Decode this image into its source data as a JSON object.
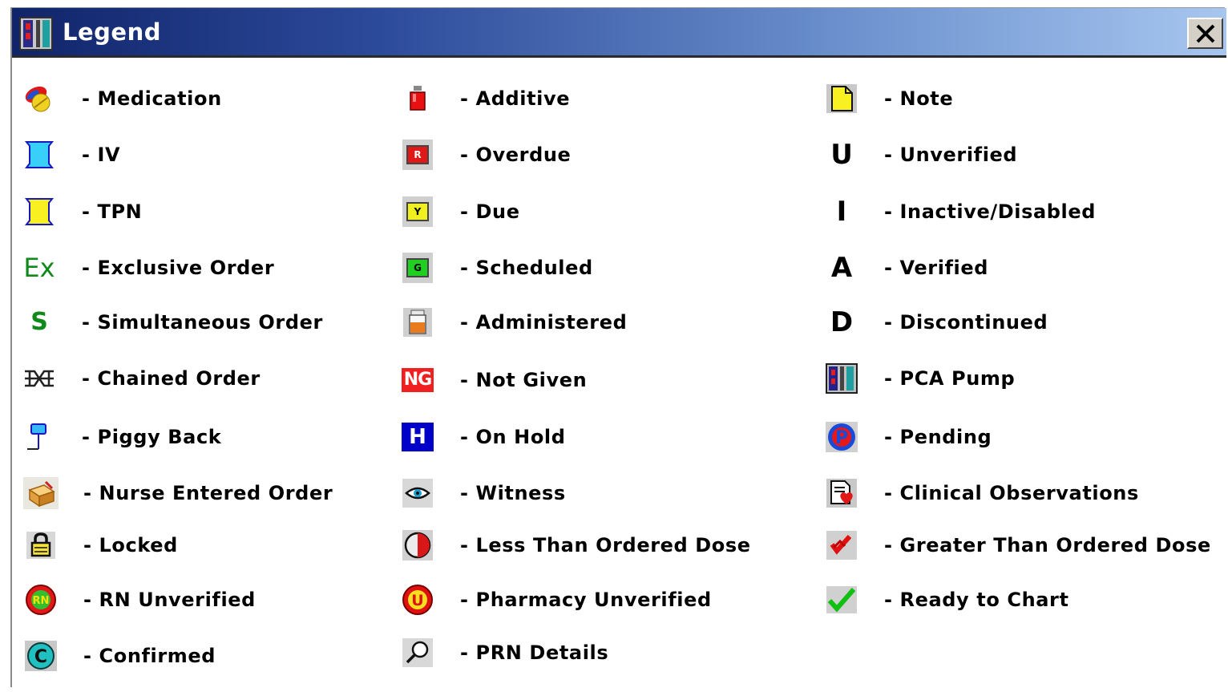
{
  "window": {
    "title": "Legend"
  },
  "columns": [
    [
      {
        "label": "- Medication",
        "icon": "medication-icon"
      },
      {
        "label": "- IV",
        "icon": "iv-bag-icon"
      },
      {
        "label": "- TPN",
        "icon": "tpn-bag-icon"
      },
      {
        "label": "- Exclusive Order",
        "icon": "exclusive-order-icon",
        "glyph": "Ex"
      },
      {
        "label": "- Simultaneous Order",
        "icon": "simultaneous-order-icon",
        "glyph": "S"
      },
      {
        "label": "- Chained Order",
        "icon": "chained-order-icon"
      },
      {
        "label": "- Piggy Back",
        "icon": "piggy-back-icon"
      },
      {
        "label": "- Nurse Entered Order",
        "icon": "nurse-entered-order-icon"
      },
      {
        "label": "- Locked",
        "icon": "lock-icon"
      },
      {
        "label": "- RN Unverified",
        "icon": "rn-unverified-icon",
        "glyph": "RN"
      },
      {
        "label": "- Confirmed",
        "icon": "confirmed-icon",
        "glyph": "C"
      }
    ],
    [
      {
        "label": "- Additive",
        "icon": "additive-icon"
      },
      {
        "label": "- Overdue",
        "icon": "overdue-icon",
        "glyph": "R"
      },
      {
        "label": "- Due",
        "icon": "due-icon",
        "glyph": "Y"
      },
      {
        "label": "- Scheduled",
        "icon": "scheduled-icon",
        "glyph": "G"
      },
      {
        "label": "- Administered",
        "icon": "administered-icon"
      },
      {
        "label": "- Not Given",
        "icon": "not-given-icon",
        "glyph": "NG"
      },
      {
        "label": "- On Hold",
        "icon": "on-hold-icon",
        "glyph": "H"
      },
      {
        "label": "- Witness",
        "icon": "witness-eye-icon"
      },
      {
        "label": "- Less Than Ordered Dose",
        "icon": "less-than-dose-icon"
      },
      {
        "label": "- Pharmacy Unverified",
        "icon": "pharmacy-unverified-icon",
        "glyph": "U"
      },
      {
        "label": "- PRN Details",
        "icon": "prn-details-magnifier-icon"
      }
    ],
    [
      {
        "label": "- Note",
        "icon": "note-icon"
      },
      {
        "label": "- Unverified",
        "icon": "unverified-icon",
        "glyph": "U"
      },
      {
        "label": "- Inactive/Disabled",
        "icon": "inactive-icon",
        "glyph": "I"
      },
      {
        "label": "- Verified",
        "icon": "verified-icon",
        "glyph": "A"
      },
      {
        "label": "- Discontinued",
        "icon": "discontinued-icon",
        "glyph": "D"
      },
      {
        "label": "- PCA Pump",
        "icon": "pca-pump-icon"
      },
      {
        "label": "- Pending",
        "icon": "pending-icon",
        "glyph": "P"
      },
      {
        "label": "- Clinical Observations",
        "icon": "clinical-observations-icon"
      },
      {
        "label": "- Greater Than Ordered Dose",
        "icon": "greater-than-dose-icon"
      },
      {
        "label": "- Ready to Chart",
        "icon": "ready-to-chart-check-icon"
      }
    ]
  ],
  "colors": {
    "title_start": "#10246a",
    "title_end": "#a7c6ef",
    "exclusive_green": "#0f8a1a",
    "hold_blue": "#0000c8",
    "not_given_red": "#e00000"
  }
}
